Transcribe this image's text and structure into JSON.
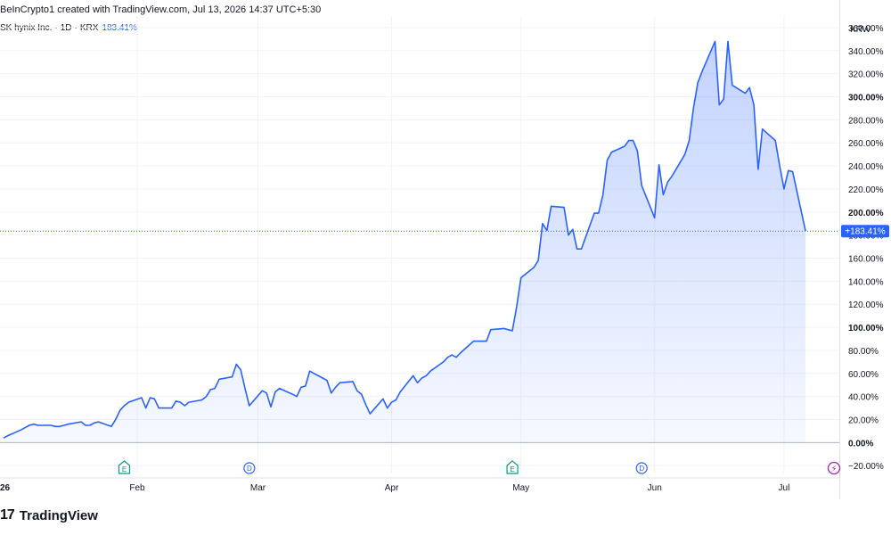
{
  "header": {
    "attribution": "BeInCrypto1 created with TradingView.com, Jul 13, 2026 14:37 UTC+5:30"
  },
  "legend": {
    "symbol": "SK hynix Inc.",
    "interval": "1D",
    "exchange": "KRX",
    "change": "183.41%"
  },
  "brand": {
    "logo": "17",
    "name": "TradingView"
  },
  "colors": {
    "line": "#2962ff",
    "fill": "#2962ff",
    "grid": "#f0f3fa",
    "axis": "#e0e3eb",
    "text": "#131722"
  },
  "chart_data": {
    "type": "area",
    "currency_label": "KRW",
    "y_unit": "percent",
    "ylim": [
      -26,
      370
    ],
    "y_ticks": [
      -20,
      0,
      20,
      40,
      60,
      80,
      100,
      120,
      140,
      160,
      180,
      200,
      220,
      240,
      260,
      280,
      300,
      320,
      340,
      360
    ],
    "y_tick_labels": [
      "−20.00%",
      "0.00%",
      "20.00%",
      "40.00%",
      "60.00%",
      "80.00%",
      "100.00%",
      "120.00%",
      "140.00%",
      "160.00%",
      "180.00%",
      "200.00%",
      "220.00%",
      "240.00%",
      "260.00%",
      "280.00%",
      "300.00%",
      "320.00%",
      "340.00%",
      "360.00%"
    ],
    "y_bold_ticks": [
      0,
      100,
      200,
      300
    ],
    "x_range": [
      "2026-01-01",
      "2026-07-13"
    ],
    "x_ticks": [
      {
        "date": "2026-01-01",
        "label": "26"
      },
      {
        "date": "2026-02-01",
        "label": "Feb"
      },
      {
        "date": "2026-03-01",
        "label": "Mar"
      },
      {
        "date": "2026-04-01",
        "label": "Apr"
      },
      {
        "date": "2026-05-01",
        "label": "May"
      },
      {
        "date": "2026-06-01",
        "label": "Jun"
      },
      {
        "date": "2026-07-01",
        "label": "Jul"
      }
    ],
    "last_value_label": "+183.41%",
    "last_value": 183.41,
    "events": [
      {
        "date": "2026-01-29",
        "letter": "E",
        "kind": "earnings"
      },
      {
        "date": "2026-02-27",
        "letter": "D",
        "kind": "dividend"
      },
      {
        "date": "2026-04-29",
        "letter": "E",
        "kind": "earnings"
      },
      {
        "date": "2026-05-29",
        "letter": "D",
        "kind": "dividend"
      },
      {
        "date": "2026-07-13",
        "letter": "⚡",
        "kind": "flash"
      }
    ],
    "series": [
      {
        "points": [
          [
            "2026-01-01",
            4
          ],
          [
            "2026-01-02",
            6
          ],
          [
            "2026-01-05",
            11
          ],
          [
            "2026-01-06",
            13
          ],
          [
            "2026-01-07",
            15
          ],
          [
            "2026-01-08",
            16
          ],
          [
            "2026-01-09",
            15
          ],
          [
            "2026-01-12",
            15
          ],
          [
            "2026-01-13",
            14
          ],
          [
            "2026-01-14",
            14
          ],
          [
            "2026-01-15",
            15
          ],
          [
            "2026-01-16",
            16
          ],
          [
            "2026-01-19",
            18
          ],
          [
            "2026-01-20",
            15
          ],
          [
            "2026-01-21",
            15
          ],
          [
            "2026-01-22",
            17
          ],
          [
            "2026-01-23",
            18
          ],
          [
            "2026-01-26",
            14
          ],
          [
            "2026-01-27",
            20
          ],
          [
            "2026-01-28",
            28
          ],
          [
            "2026-01-29",
            32
          ],
          [
            "2026-01-30",
            35
          ],
          [
            "2026-02-02",
            39
          ],
          [
            "2026-02-03",
            30
          ],
          [
            "2026-02-04",
            39
          ],
          [
            "2026-02-05",
            38
          ],
          [
            "2026-02-06",
            30
          ],
          [
            "2026-02-09",
            30
          ],
          [
            "2026-02-10",
            36
          ],
          [
            "2026-02-11",
            35
          ],
          [
            "2026-02-12",
            32
          ],
          [
            "2026-02-13",
            35
          ],
          [
            "2026-02-16",
            37
          ],
          [
            "2026-02-17",
            40
          ],
          [
            "2026-02-18",
            46
          ],
          [
            "2026-02-19",
            47
          ],
          [
            "2026-02-20",
            55
          ],
          [
            "2026-02-23",
            57
          ],
          [
            "2026-02-24",
            68
          ],
          [
            "2026-02-25",
            63
          ],
          [
            "2026-02-26",
            47
          ],
          [
            "2026-02-27",
            32
          ],
          [
            "2026-03-02",
            45
          ],
          [
            "2026-03-03",
            43
          ],
          [
            "2026-03-04",
            31
          ],
          [
            "2026-03-05",
            44
          ],
          [
            "2026-03-06",
            47
          ],
          [
            "2026-03-09",
            42
          ],
          [
            "2026-03-10",
            40
          ],
          [
            "2026-03-11",
            48
          ],
          [
            "2026-03-12",
            49
          ],
          [
            "2026-03-13",
            62
          ],
          [
            "2026-03-16",
            56
          ],
          [
            "2026-03-17",
            54
          ],
          [
            "2026-03-18",
            43
          ],
          [
            "2026-03-19",
            48
          ],
          [
            "2026-03-20",
            52
          ],
          [
            "2026-03-23",
            53
          ],
          [
            "2026-03-24",
            45
          ],
          [
            "2026-03-25",
            42
          ],
          [
            "2026-03-26",
            33
          ],
          [
            "2026-03-27",
            25
          ],
          [
            "2026-03-30",
            38
          ],
          [
            "2026-03-31",
            30
          ],
          [
            "2026-04-01",
            35
          ],
          [
            "2026-04-02",
            37
          ],
          [
            "2026-04-03",
            44
          ],
          [
            "2026-04-06",
            58
          ],
          [
            "2026-04-07",
            52
          ],
          [
            "2026-04-08",
            56
          ],
          [
            "2026-04-09",
            58
          ],
          [
            "2026-04-10",
            62
          ],
          [
            "2026-04-13",
            70
          ],
          [
            "2026-04-14",
            74
          ],
          [
            "2026-04-15",
            76
          ],
          [
            "2026-04-16",
            74
          ],
          [
            "2026-04-17",
            78
          ],
          [
            "2026-04-20",
            88
          ],
          [
            "2026-04-21",
            88
          ],
          [
            "2026-04-22",
            88
          ],
          [
            "2026-04-23",
            88
          ],
          [
            "2026-04-24",
            98
          ],
          [
            "2026-04-27",
            99
          ],
          [
            "2026-04-28",
            98
          ],
          [
            "2026-04-29",
            97
          ],
          [
            "2026-04-30",
            118
          ],
          [
            "2026-05-01",
            143
          ],
          [
            "2026-05-04",
            152
          ],
          [
            "2026-05-05",
            158
          ],
          [
            "2026-05-06",
            190
          ],
          [
            "2026-05-07",
            184
          ],
          [
            "2026-05-08",
            205
          ],
          [
            "2026-05-11",
            204
          ],
          [
            "2026-05-12",
            180
          ],
          [
            "2026-05-13",
            185
          ],
          [
            "2026-05-14",
            168
          ],
          [
            "2026-05-15",
            168
          ],
          [
            "2026-05-18",
            199
          ],
          [
            "2026-05-19",
            199
          ],
          [
            "2026-05-20",
            215
          ],
          [
            "2026-05-21",
            245
          ],
          [
            "2026-05-22",
            252
          ],
          [
            "2026-05-25",
            257
          ],
          [
            "2026-05-26",
            262
          ],
          [
            "2026-05-27",
            262
          ],
          [
            "2026-05-28",
            253
          ],
          [
            "2026-05-29",
            223
          ],
          [
            "2026-06-01",
            195
          ],
          [
            "2026-06-02",
            241
          ],
          [
            "2026-06-03",
            215
          ],
          [
            "2026-06-04",
            226
          ],
          [
            "2026-06-05",
            231
          ],
          [
            "2026-06-08",
            250
          ],
          [
            "2026-06-09",
            262
          ],
          [
            "2026-06-10",
            290
          ],
          [
            "2026-06-11",
            312
          ],
          [
            "2026-06-12",
            322
          ],
          [
            "2026-06-15",
            348
          ],
          [
            "2026-06-16",
            293
          ],
          [
            "2026-06-17",
            298
          ],
          [
            "2026-06-18",
            348
          ],
          [
            "2026-06-19",
            310
          ],
          [
            "2026-06-22",
            303
          ],
          [
            "2026-06-23",
            308
          ],
          [
            "2026-06-24",
            293
          ],
          [
            "2026-06-25",
            237
          ],
          [
            "2026-06-26",
            272
          ],
          [
            "2026-06-29",
            262
          ],
          [
            "2026-06-30",
            240
          ],
          [
            "2026-07-01",
            220
          ],
          [
            "2026-07-02",
            236
          ],
          [
            "2026-07-03",
            235
          ],
          [
            "2026-07-06",
            183.41
          ]
        ]
      }
    ]
  }
}
